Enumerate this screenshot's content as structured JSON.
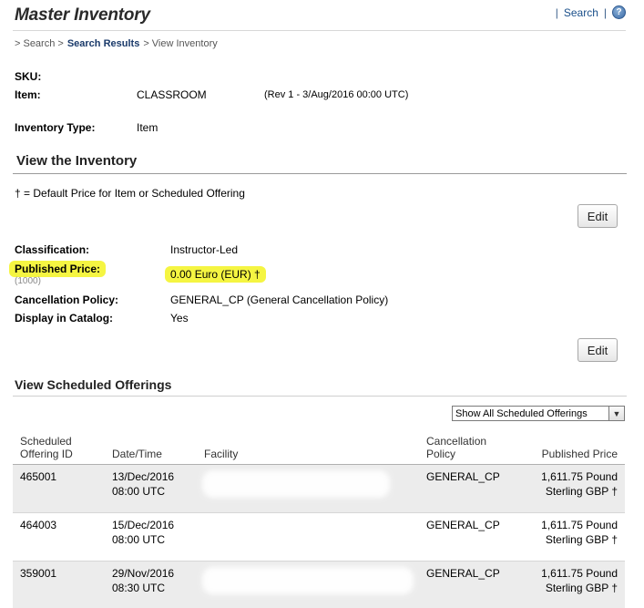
{
  "header": {
    "title": "Master Inventory",
    "search_link": "Search",
    "help_icon": "?"
  },
  "breadcrumb": {
    "items": [
      "> Search >",
      "Search Results",
      "> View Inventory"
    ]
  },
  "item_info": {
    "sku_label": "SKU:",
    "sku_value": "",
    "item_label": "Item:",
    "item_value": "CLASSROOM",
    "item_rev": "(Rev 1 - 3/Aug/2016 00:00 UTC)",
    "inventory_type_label": "Inventory Type:",
    "inventory_type_value": "Item"
  },
  "view_inventory": {
    "heading": "View the Inventory",
    "legend": "†   = Default Price for Item or Scheduled Offering",
    "edit_label": "Edit",
    "classification_label": "Classification:",
    "classification_value": "Instructor-Led",
    "published_price_label": "Published Price:",
    "published_price_sub": "(1000)",
    "published_price_value": "0.00 Euro (EUR) †",
    "cancellation_label": "Cancellation Policy:",
    "cancellation_value": "GENERAL_CP (General Cancellation Policy)",
    "display_catalog_label": "Display in Catalog:",
    "display_catalog_value": "Yes",
    "edit_label_2": "Edit",
    "highlight_color": "#f5f542"
  },
  "scheduled": {
    "heading": "View Scheduled Offerings",
    "filter_value": "Show All Scheduled Offerings",
    "columns": {
      "id_line1": "Scheduled",
      "id_line2": "Offering ID",
      "date": "Date/Time",
      "facility": "Facility",
      "cancel_line1": "Cancellation",
      "cancel_line2": "Policy",
      "price": "Published Price"
    },
    "rows": [
      {
        "id": "465001",
        "date": "13/Dec/2016",
        "time": "08:00 UTC",
        "cancel": "GENERAL_CP",
        "price1": "1,611.75 Pound",
        "price2": "Sterling GBP †"
      },
      {
        "id": "464003",
        "date": "15/Dec/2016",
        "time": "08:00 UTC",
        "cancel": "GENERAL_CP",
        "price1": "1,611.75 Pound",
        "price2": "Sterling GBP †"
      },
      {
        "id": "359001",
        "date": "29/Nov/2016",
        "time": "08:30 UTC",
        "cancel": "GENERAL_CP",
        "price1": "1,611.75 Pound",
        "price2": "Sterling GBP †"
      }
    ]
  }
}
